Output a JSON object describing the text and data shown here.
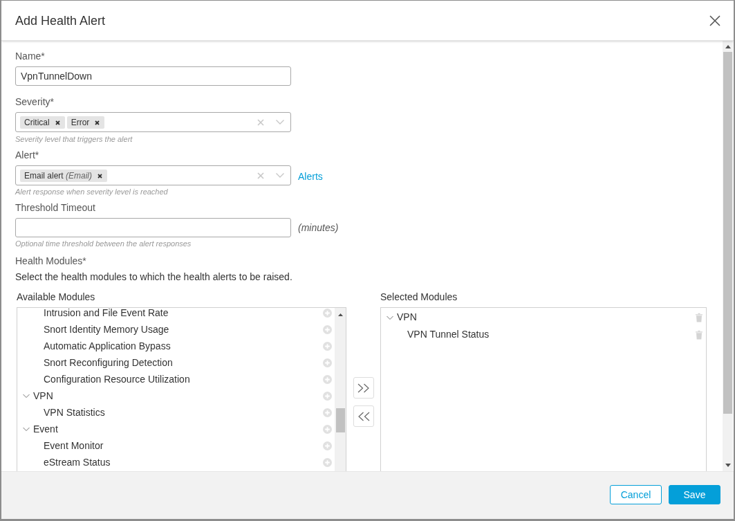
{
  "dialog": {
    "title": "Add Health Alert"
  },
  "name_field": {
    "label": "Name*",
    "value": "VpnTunnelDown"
  },
  "severity_field": {
    "label": "Severity*",
    "tags": [
      "Critical",
      "Error"
    ],
    "hint": "Severity level that triggers the alert"
  },
  "alert_field": {
    "label": "Alert*",
    "tags": [
      "Email alert *(Email)*"
    ],
    "link": "Alerts",
    "hint": "Alert response when severity level is reached"
  },
  "threshold_field": {
    "label": "Threshold Timeout",
    "unit": "(minutes)",
    "hint": "Optional time threshold between the alert responses"
  },
  "health_modules": {
    "label": "Health Modules*",
    "description": "Select the health modules to which the health alerts to be raised.",
    "available": {
      "title": "Available Modules",
      "items": [
        {
          "kind": "module",
          "label": "Intrusion and File Event Rate"
        },
        {
          "kind": "module",
          "label": "Snort Identity Memory Usage"
        },
        {
          "kind": "module",
          "label": "Automatic Application Bypass"
        },
        {
          "kind": "module",
          "label": "Snort Reconfiguring Detection"
        },
        {
          "kind": "module",
          "label": "Configuration Resource Utilization"
        },
        {
          "kind": "group",
          "label": "VPN",
          "expanded": true,
          "children": [
            {
              "kind": "module",
              "label": "VPN Statistics"
            }
          ]
        },
        {
          "kind": "group",
          "label": "Event",
          "expanded": true,
          "children": [
            {
              "kind": "module",
              "label": "Event Monitor"
            },
            {
              "kind": "module",
              "label": "eStream Status"
            }
          ]
        }
      ]
    },
    "selected": {
      "title": "Selected Modules",
      "items": [
        {
          "kind": "group",
          "label": "VPN",
          "expanded": true,
          "children": [
            {
              "kind": "module",
              "label": "VPN Tunnel Status"
            }
          ]
        }
      ]
    }
  },
  "buttons": [
    {
      "label": "Cancel",
      "kind": "secondary"
    },
    {
      "label": "Save",
      "kind": "primary"
    }
  ]
}
